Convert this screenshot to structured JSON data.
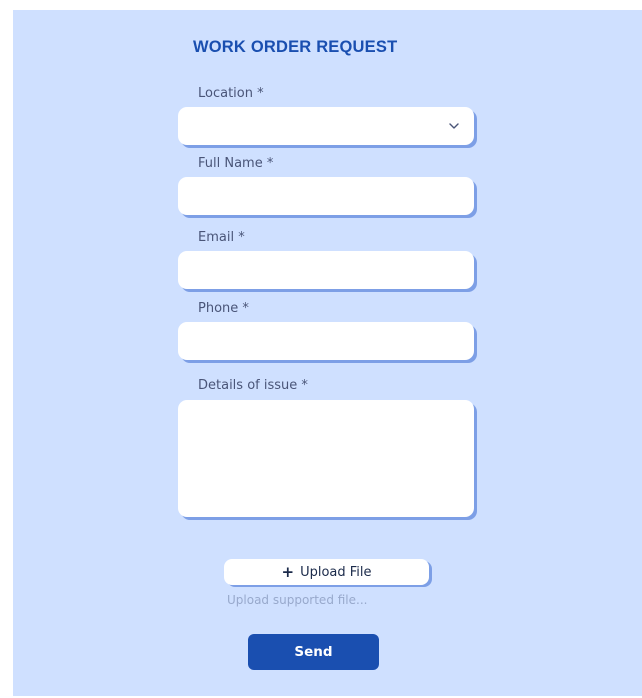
{
  "form": {
    "title": "WORK ORDER REQUEST",
    "fields": {
      "location": {
        "label": "Location *",
        "value": ""
      },
      "full_name": {
        "label": "Full Name *",
        "value": ""
      },
      "email": {
        "label": "Email *",
        "value": ""
      },
      "phone": {
        "label": "Phone *",
        "value": ""
      },
      "details": {
        "label": "Details of issue *",
        "value": ""
      }
    },
    "upload": {
      "plus": "+",
      "label": "Upload File",
      "hint": "Upload supported file..."
    },
    "send_label": "Send"
  },
  "colors": {
    "background": "#cfe0ff",
    "accent": "#1a4fb0",
    "field_shadow": "#7d9fe6",
    "hint_text": "#98a9cc"
  },
  "icons": {
    "location_dropdown": "chevron-down-icon"
  }
}
